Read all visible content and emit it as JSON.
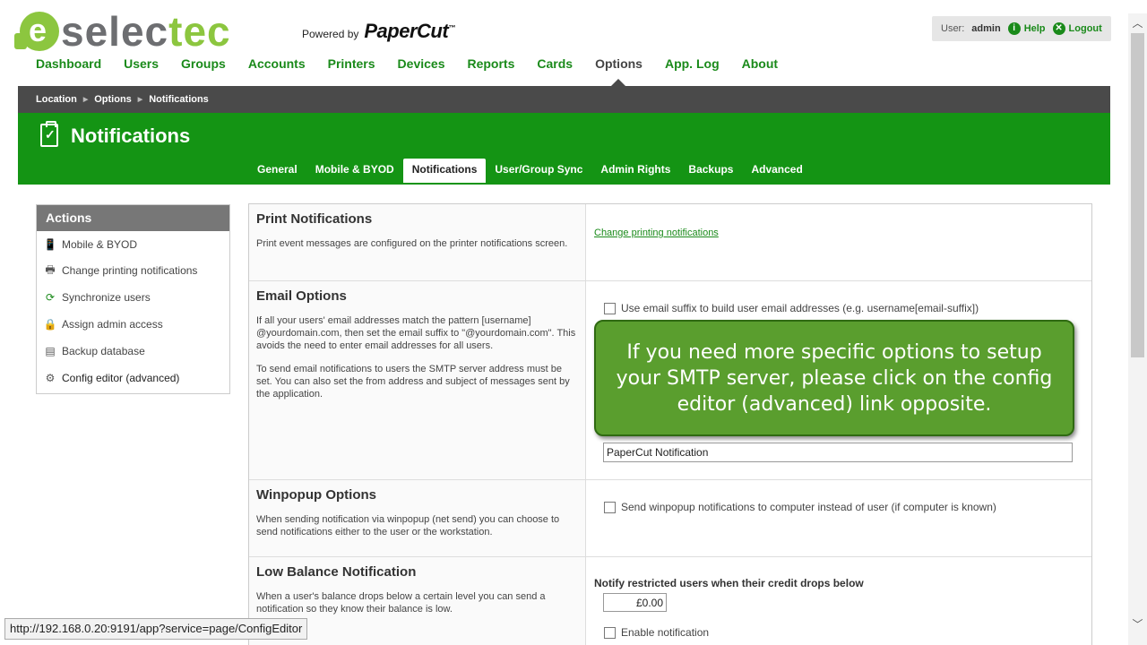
{
  "header": {
    "logo_prefix": "selec",
    "logo_suffix": "tec",
    "powered_by": "Powered by",
    "brand": "PaperCut",
    "brand_tm": "™"
  },
  "user": {
    "label": "User:",
    "name": "admin",
    "help": "Help",
    "logout": "Logout"
  },
  "nav": [
    {
      "label": "Dashboard"
    },
    {
      "label": "Users"
    },
    {
      "label": "Groups"
    },
    {
      "label": "Accounts"
    },
    {
      "label": "Printers"
    },
    {
      "label": "Devices"
    },
    {
      "label": "Reports"
    },
    {
      "label": "Cards"
    },
    {
      "label": "Options",
      "active": true
    },
    {
      "label": "App. Log"
    },
    {
      "label": "About"
    }
  ],
  "breadcrumb": [
    "Location",
    "Options",
    "Notifications"
  ],
  "page_title": "Notifications",
  "tabs": [
    {
      "label": "General"
    },
    {
      "label": "Mobile & BYOD"
    },
    {
      "label": "Notifications",
      "active": true
    },
    {
      "label": "User/Group Sync"
    },
    {
      "label": "Admin Rights"
    },
    {
      "label": "Backups"
    },
    {
      "label": "Advanced"
    }
  ],
  "actions": {
    "title": "Actions",
    "items": [
      {
        "label": "Mobile & BYOD",
        "icon": "mobile-icon"
      },
      {
        "label": "Change printing notifications",
        "icon": "printer-icon"
      },
      {
        "label": "Synchronize users",
        "icon": "sync-icon"
      },
      {
        "label": "Assign admin access",
        "icon": "lock-icon"
      },
      {
        "label": "Backup database",
        "icon": "database-icon"
      },
      {
        "label": "Config editor (advanced)",
        "icon": "gear-icon"
      }
    ]
  },
  "sections": {
    "print": {
      "title": "Print Notifications",
      "desc": "Print event messages are configured on the printer notifications screen.",
      "link": "Change printing notifications"
    },
    "email": {
      "title": "Email Options",
      "desc1": "If all your users' email addresses match the pattern [username] @yourdomain.com, then set the email suffix to \"@yourdomain.com\". This avoids the need to enter email addresses for all users.",
      "desc2": "To send email notifications to users the SMTP server address must be set. You can also set the from address and subject of messages sent by the application.",
      "suffix_label": "Use email suffix to build user email addresses (e.g. username[email-suffix])",
      "subject_value": "PaperCut Notification"
    },
    "winpopup": {
      "title": "Winpopup Options",
      "desc": "When sending notification via winpopup (net send) you can choose to send notifications either to the user or the workstation.",
      "checkbox": "Send winpopup notifications to computer instead of user (if computer is known)"
    },
    "lowbalance": {
      "title": "Low Balance Notification",
      "desc": "When a user's balance drops below a certain level you can send a notification so they know their balance is low.",
      "notify_label": "Notify restricted users when their credit drops below",
      "amount": "£0.00",
      "enable_label": "Enable notification"
    }
  },
  "callout": "If you need more specific options to setup your SMTP server,  please click on the config editor (advanced) link opposite.",
  "status_url": "http://192.168.0.20:9191/app?service=page/ConfigEditor",
  "colors": {
    "brand_green": "#149414",
    "link_green": "#1a8a1a",
    "callout_green": "#5a9e2e",
    "dark_bar": "#4a4a4a"
  }
}
